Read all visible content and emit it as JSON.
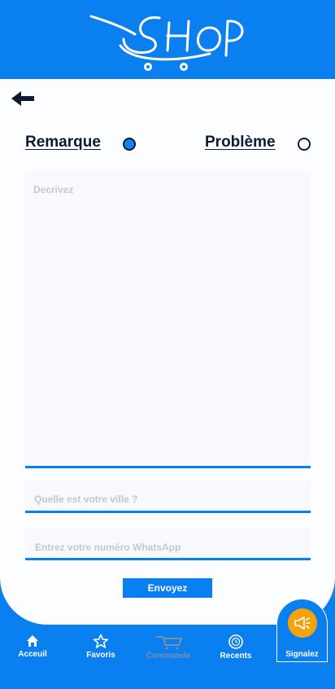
{
  "header": {
    "logo_text": "SHOP"
  },
  "options": {
    "remarque": {
      "label": "Remarque",
      "selected": true
    },
    "probleme": {
      "label": "Problème",
      "selected": false
    }
  },
  "form": {
    "description_placeholder": "Decrivez",
    "city_placeholder": "Quelle est votre ville ?",
    "whatsapp_placeholder": "Entrez votre numéro WhatsApp",
    "submit_label": "Envoyez"
  },
  "nav": {
    "items": [
      {
        "label": "Acceuil",
        "icon": "home-icon"
      },
      {
        "label": "Favoris",
        "icon": "star-icon"
      },
      {
        "label": "Commande",
        "icon": "cart-icon",
        "disabled": true
      },
      {
        "label": "Recents",
        "icon": "clock-icon"
      },
      {
        "label": "Signalez",
        "icon": "megaphone-icon",
        "active": true
      }
    ]
  },
  "colors": {
    "brand_blue": "#0a7ff0",
    "accent_orange": "#f5a30c",
    "text_dark": "#0c1a36"
  }
}
